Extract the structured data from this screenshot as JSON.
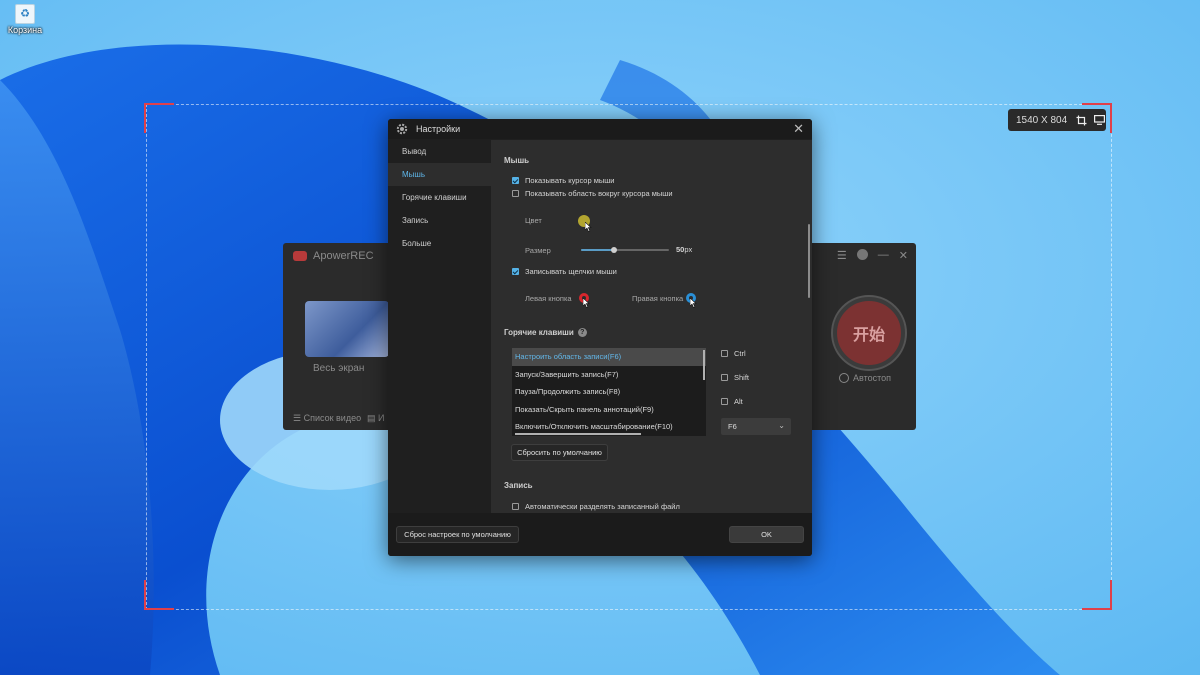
{
  "desktop": {
    "recycle_bin_label": "Корзина"
  },
  "capture": {
    "size_label": "1540 X 804",
    "crop_icon": "crop-icon",
    "screen_icon": "monitor-icon"
  },
  "apowerrec": {
    "title": "ApowerREC",
    "fullscreen_label": "Весь экран",
    "list_label": "Список видео",
    "list2_label": "И",
    "start_label": "开始",
    "autostop_label": "Автостоп"
  },
  "dialog": {
    "title": "Настройки",
    "nav": [
      {
        "label": "Вывод"
      },
      {
        "label": "Мышь"
      },
      {
        "label": "Горячие клавиши"
      },
      {
        "label": "Запись"
      },
      {
        "label": "Больше"
      }
    ],
    "mouse": {
      "title": "Мышь",
      "show_cursor": "Показывать курсор мыши",
      "show_cursor_checked": true,
      "show_area": "Показывать область вокруг курсора мыши",
      "show_area_checked": false,
      "color_label": "Цвет",
      "area_color": "#b2a530",
      "size_label": "Размер",
      "size_value": "50",
      "size_unit": "px",
      "size_fraction": 0.38,
      "record_clicks": "Записывать щелчки мыши",
      "record_clicks_checked": true,
      "left_button": "Левая кнопка",
      "left_color": "#d8262d",
      "right_button": "Правая кнопка",
      "right_color": "#2a8fd6"
    },
    "hotkeys": {
      "title": "Горячие клавиши",
      "help": "?",
      "items": [
        "Настроить область записи(F6)",
        "Запуск/Завершить запись(F7)",
        "Пауза/Продолжить запись(F8)",
        "Показать/Скрыть панель аннотаций(F9)",
        "Включить/Отключить масштабирование(F10)"
      ],
      "modifiers": [
        "Ctrl",
        "Shift",
        "Alt"
      ],
      "key_value": "F6",
      "reset_label": "Сбросить по умолчанию"
    },
    "record": {
      "title": "Запись",
      "auto_split": "Автоматически разделять записанный файл"
    },
    "footer": {
      "reset_all": "Сброс настроек по умолчанию",
      "ok": "OK"
    }
  }
}
